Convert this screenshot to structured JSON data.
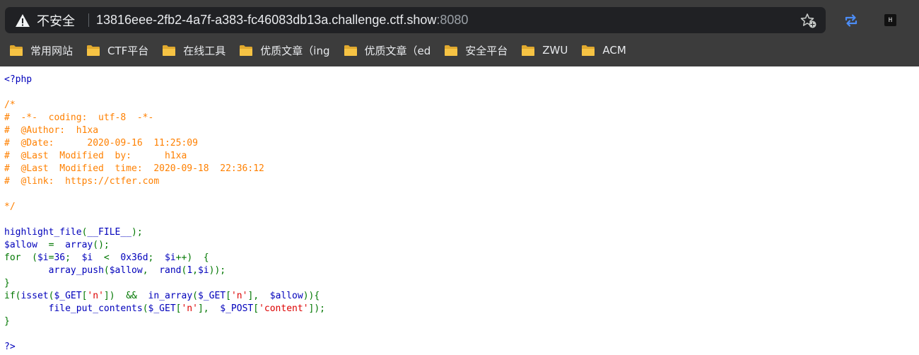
{
  "browser": {
    "security_label": "不安全",
    "url_host": "13816eee-2fb2-4a7f-a383-fc46083db13a.challenge.ctf.show",
    "url_port": ":8080",
    "extension_h_label": "H"
  },
  "bookmarks": [
    {
      "label": "常用网站"
    },
    {
      "label": "CTF平台"
    },
    {
      "label": "在线工具"
    },
    {
      "label": "优质文章（ing"
    },
    {
      "label": "优质文章（ed"
    },
    {
      "label": "安全平台"
    },
    {
      "label": "ZWU"
    },
    {
      "label": "ACM"
    }
  ],
  "code_lines": [
    [
      {
        "t": "<?php",
        "c": "def"
      }
    ],
    [],
    [
      {
        "t": "/*",
        "c": "cmt"
      }
    ],
    [
      {
        "t": "#  -*-  coding:  utf-8  -*-",
        "c": "cmt"
      }
    ],
    [
      {
        "t": "#  @Author:  h1xa",
        "c": "cmt"
      }
    ],
    [
      {
        "t": "#  @Date:      2020-09-16  11:25:09",
        "c": "cmt"
      }
    ],
    [
      {
        "t": "#  @Last  Modified  by:      h1xa",
        "c": "cmt"
      }
    ],
    [
      {
        "t": "#  @Last  Modified  time:  2020-09-18  22:36:12",
        "c": "cmt"
      }
    ],
    [
      {
        "t": "#  @link:  https://ctfer.com",
        "c": "cmt"
      }
    ],
    [],
    [
      {
        "t": "*/",
        "c": "cmt"
      }
    ],
    [],
    [
      {
        "t": "highlight_file",
        "c": "def"
      },
      {
        "t": "(",
        "c": "kw"
      },
      {
        "t": "__FILE__",
        "c": "def"
      },
      {
        "t": ");",
        "c": "kw"
      }
    ],
    [
      {
        "t": "$allow  ",
        "c": "def"
      },
      {
        "t": "=  ",
        "c": "kw"
      },
      {
        "t": "array",
        "c": "def"
      },
      {
        "t": "();",
        "c": "kw"
      }
    ],
    [
      {
        "t": "for  (",
        "c": "kw"
      },
      {
        "t": "$i",
        "c": "def"
      },
      {
        "t": "=",
        "c": "kw"
      },
      {
        "t": "36",
        "c": "def"
      },
      {
        "t": ";  ",
        "c": "kw"
      },
      {
        "t": "$i  ",
        "c": "def"
      },
      {
        "t": "<  ",
        "c": "kw"
      },
      {
        "t": "0x36d",
        "c": "def"
      },
      {
        "t": ";  ",
        "c": "kw"
      },
      {
        "t": "$i",
        "c": "def"
      },
      {
        "t": "++)  {",
        "c": "kw"
      }
    ],
    [
      {
        "t": "        ",
        "c": "def"
      },
      {
        "t": "array_push",
        "c": "def"
      },
      {
        "t": "(",
        "c": "kw"
      },
      {
        "t": "$allow",
        "c": "def"
      },
      {
        "t": ",  ",
        "c": "kw"
      },
      {
        "t": "rand",
        "c": "def"
      },
      {
        "t": "(",
        "c": "kw"
      },
      {
        "t": "1",
        "c": "def"
      },
      {
        "t": ",",
        "c": "kw"
      },
      {
        "t": "$i",
        "c": "def"
      },
      {
        "t": "));",
        "c": "kw"
      }
    ],
    [
      {
        "t": "}",
        "c": "kw"
      }
    ],
    [
      {
        "t": "if(",
        "c": "kw"
      },
      {
        "t": "isset",
        "c": "def"
      },
      {
        "t": "(",
        "c": "kw"
      },
      {
        "t": "$_GET",
        "c": "def"
      },
      {
        "t": "[",
        "c": "kw"
      },
      {
        "t": "'n'",
        "c": "str"
      },
      {
        "t": "])  &&  ",
        "c": "kw"
      },
      {
        "t": "in_array",
        "c": "def"
      },
      {
        "t": "(",
        "c": "kw"
      },
      {
        "t": "$_GET",
        "c": "def"
      },
      {
        "t": "[",
        "c": "kw"
      },
      {
        "t": "'n'",
        "c": "str"
      },
      {
        "t": "],  ",
        "c": "kw"
      },
      {
        "t": "$allow",
        "c": "def"
      },
      {
        "t": ")){",
        "c": "kw"
      }
    ],
    [
      {
        "t": "        ",
        "c": "def"
      },
      {
        "t": "file_put_contents",
        "c": "def"
      },
      {
        "t": "(",
        "c": "kw"
      },
      {
        "t": "$_GET",
        "c": "def"
      },
      {
        "t": "[",
        "c": "kw"
      },
      {
        "t": "'n'",
        "c": "str"
      },
      {
        "t": "],  ",
        "c": "kw"
      },
      {
        "t": "$_POST",
        "c": "def"
      },
      {
        "t": "[",
        "c": "kw"
      },
      {
        "t": "'content'",
        "c": "str"
      },
      {
        "t": "]);",
        "c": "kw"
      }
    ],
    [
      {
        "t": "}",
        "c": "kw"
      }
    ],
    [],
    [
      {
        "t": "?>",
        "c": "def"
      }
    ]
  ],
  "colors": {
    "chrome_frame": "#3c3c3c",
    "omnibox": "#202124",
    "folder": "#f6c344",
    "code_default": "#0000bb",
    "code_comment": "#ff8000",
    "code_keyword": "#007700",
    "code_string": "#dd0000",
    "sync_icon": "#4c8df6"
  },
  "icons": {
    "security": "warning-triangle-icon",
    "star": "star-plus-icon",
    "sync": "sync-icon",
    "extension": "h-extension-icon",
    "folder": "folder-icon"
  }
}
